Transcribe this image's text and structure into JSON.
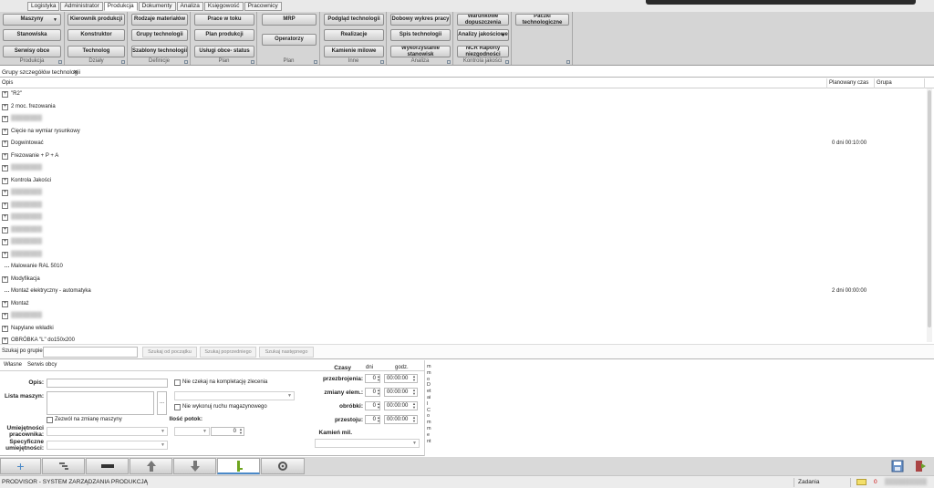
{
  "tabs": [
    "Logistyka",
    "Administrator",
    "Produkcja",
    "Dokumenty",
    "Analiza",
    "Księgowość",
    "Pracownicy"
  ],
  "active_tab": "Produkcja",
  "ribbon": {
    "groups": [
      {
        "label": "Produkcja",
        "buttons": [
          "Maszyny",
          "Stanowiska",
          "Serwisy obce"
        ]
      },
      {
        "label": "Działy",
        "buttons": [
          "Kierownik produkcji",
          "Konstruktor",
          "Technolog"
        ]
      },
      {
        "label": "Definicje",
        "buttons": [
          "Rodzaje materiałów",
          "Grupy technologii",
          "Szablony technologii"
        ]
      },
      {
        "label": "Plan",
        "buttons": [
          "Prace w toku",
          "Plan produkcji",
          "Usługi obce- status"
        ]
      },
      {
        "label": "Plan",
        "buttons": [
          "MRP",
          "Operatorzy"
        ]
      },
      {
        "label": "Inne",
        "buttons": [
          "Podgląd technologii",
          "Realizacje",
          "Kamienie milowe"
        ]
      },
      {
        "label": "Analiza",
        "buttons": [
          "Dobowy wykres pracy",
          "Spis technologii",
          "Wykorzystanie stanowisk"
        ]
      },
      {
        "label": "Kontrola jakości",
        "buttons": [
          "Warunkowe dopuszczenia",
          "Analizy jakościowe",
          "NCR Raporty niezgodności"
        ]
      },
      {
        "label": "",
        "buttons": [
          "Paczki technologiczne"
        ]
      }
    ]
  },
  "doc_tab": {
    "title": "Grupy szczegółów technologii",
    "close": "✕"
  },
  "table": {
    "columns": [
      "Opis",
      "Planowany czas",
      "Grupa"
    ],
    "rows": [
      {
        "text": "\"R2\"",
        "time": "",
        "expandable": true,
        "blurred": false
      },
      {
        "text": "2 moc. frezowania",
        "time": "",
        "expandable": true,
        "blurred": false
      },
      {
        "text": "",
        "time": "",
        "expandable": true,
        "blurred": true
      },
      {
        "text": "Cięcie na wymiar rysunkowy",
        "time": "",
        "expandable": true,
        "blurred": false
      },
      {
        "text": "Dogwintować",
        "time": "0 dni 00:10:00",
        "expandable": true,
        "blurred": false
      },
      {
        "text": "Frezowanie + P + A",
        "time": "",
        "expandable": true,
        "blurred": false
      },
      {
        "text": "",
        "time": "",
        "expandable": true,
        "blurred": true
      },
      {
        "text": "Kontrola Jakości",
        "time": "",
        "expandable": true,
        "blurred": false
      },
      {
        "text": "",
        "time": "",
        "expandable": true,
        "blurred": true
      },
      {
        "text": "",
        "time": "",
        "expandable": true,
        "blurred": true
      },
      {
        "text": "",
        "time": "",
        "expandable": true,
        "blurred": true
      },
      {
        "text": "",
        "time": "",
        "expandable": true,
        "blurred": true
      },
      {
        "text": "",
        "time": "",
        "expandable": true,
        "blurred": true
      },
      {
        "text": "",
        "time": "",
        "expandable": true,
        "blurred": true
      },
      {
        "text": "Malowanie RAL 5010",
        "time": "",
        "expandable": false,
        "blurred": false
      },
      {
        "text": "Modyfikacja",
        "time": "",
        "expandable": true,
        "blurred": false
      },
      {
        "text": "Montaż elektryczny - automatyka",
        "time": "2 dni 00:00:00",
        "expandable": false,
        "blurred": false
      },
      {
        "text": "Montaż",
        "time": "",
        "expandable": true,
        "blurred": false
      },
      {
        "text": "",
        "time": "",
        "expandable": true,
        "blurred": true
      },
      {
        "text": "Napylane wkładki",
        "time": "",
        "expandable": true,
        "blurred": false
      },
      {
        "text": "OBRÓBKA \"L\" do150x200",
        "time": "",
        "expandable": true,
        "blurred": false
      }
    ]
  },
  "search": {
    "label": "Szukaj po grupie:",
    "btn_first": "Szukaj od początku",
    "btn_prev": "Szukaj poprzedniego",
    "btn_next": "Szukaj następnego"
  },
  "form": {
    "tab_own": "Własne",
    "tab_service": "Serwis obcy",
    "opis_label": "Opis:",
    "maszyny_label": "Lista maszyn:",
    "maszyny_btn": "...",
    "zezwol": "Zezwól na zmianę maszyny",
    "umiejetnosci_label": "Umiejętności pracownika:",
    "specyficzne_label": "Specyficzne umiejętności:",
    "nie_czekaj": "Nie czekaj na kompletację zlecenia",
    "nie_wykonuj": "Nie wykonuj ruchu magazynowego",
    "ilosc_label": "Ilość potok:",
    "ilosc_value": "0",
    "czasy_label": "Czasy",
    "dni_label": "dni",
    "godz_label": "godz.",
    "times": [
      {
        "label": "przezbrojenia:",
        "dni": "0",
        "godz": "00:00:00"
      },
      {
        "label": "zmiany elem.:",
        "dni": "0",
        "godz": "00:00:00"
      },
      {
        "label": "obróbki:",
        "dni": "0",
        "godz": "00:00:00"
      },
      {
        "label": "przestoju:",
        "dni": "0",
        "godz": "00:00:00"
      }
    ],
    "kamien_label": "Kamień mil.",
    "memo_text": "mmoDetailComment"
  },
  "status": {
    "app": "PRODVISOR - SYSTEM ZARZĄDZANIA PRODUKCJĄ",
    "zadania": "Zadania",
    "mail_count": "0"
  },
  "icons": {
    "plus": "plus-icon",
    "filter": "filter-icon",
    "minus": "minus-icon",
    "up": "arrow-up-icon",
    "down": "arrow-down-icon",
    "tool": "key-icon",
    "settings": "settings-icon"
  }
}
